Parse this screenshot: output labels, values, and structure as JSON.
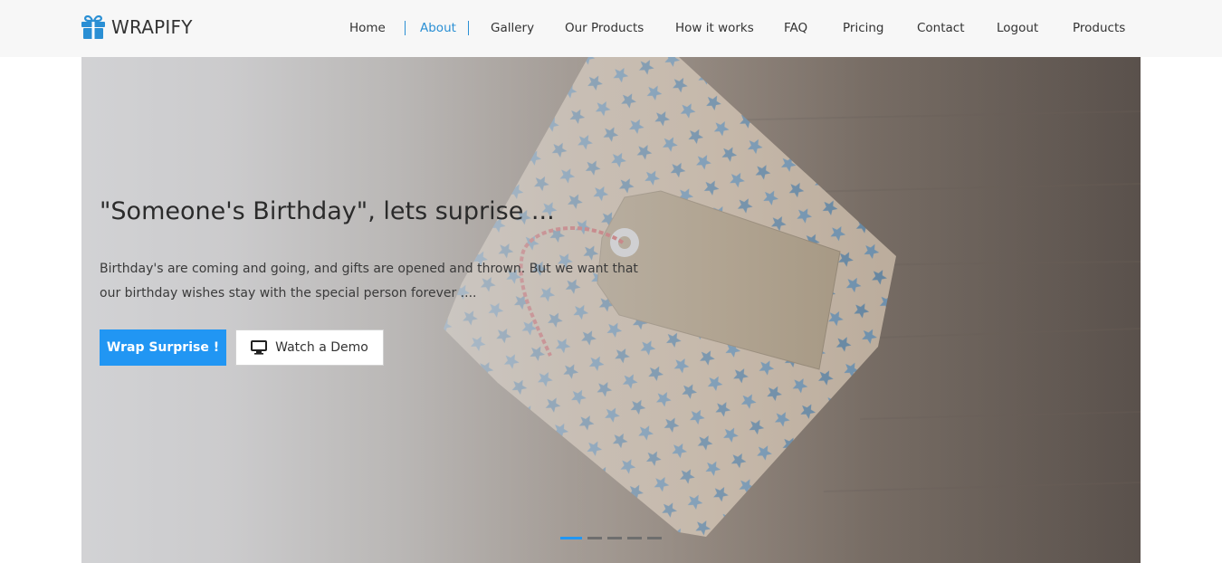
{
  "brand": {
    "name": "WRAPIFY",
    "icon": "gift-icon",
    "color": "#2a8fd4"
  },
  "nav": {
    "items": [
      {
        "label": "Home",
        "active": false
      },
      {
        "label": "About",
        "active": true
      },
      {
        "label": "Gallery",
        "active": false
      },
      {
        "label": "Our Products",
        "active": false
      },
      {
        "label": "How it works",
        "active": false
      },
      {
        "label": "FAQ",
        "active": false
      },
      {
        "label": "Pricing",
        "active": false
      },
      {
        "label": "Contact",
        "active": false
      },
      {
        "label": "Logout",
        "active": false
      },
      {
        "label": "Products",
        "active": false
      }
    ],
    "active_color": "#2a8fd4"
  },
  "hero": {
    "title": "\"Someone's Birthday\", lets suprise ...",
    "text": "Birthday's are coming and going, and gifts are opened and thrown. But we want that our birthday wishes stay with the special person forever ....",
    "primary_button": "Wrap Surprise !",
    "secondary_button": "Watch a Demo",
    "secondary_icon": "monitor-icon",
    "primary_color": "#2196f3",
    "background_image": "gift-with-tag-on-wood"
  },
  "carousel": {
    "slides": 5,
    "active_index": 0
  }
}
